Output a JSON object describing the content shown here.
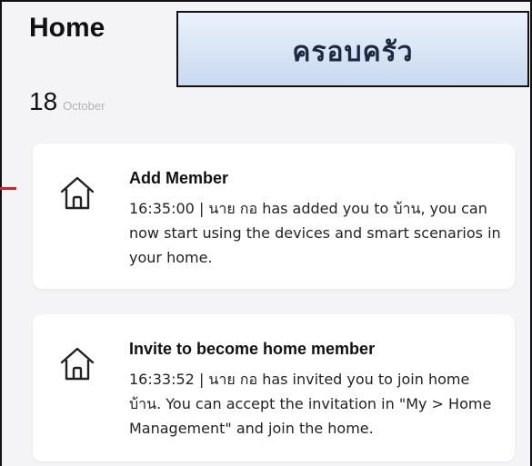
{
  "header": {
    "title": "Home",
    "banner_text": "ครอบครัว"
  },
  "date": {
    "day": "18",
    "month": "October"
  },
  "notifications": [
    {
      "icon": "home-icon",
      "title": "Add Member",
      "body": "16:35:00 | นาย กอ has added you to บ้าน, you can now start using the devices and smart scenarios in your home."
    },
    {
      "icon": "home-icon",
      "title": "Invite to become home member",
      "body": "16:33:52 | นาย กอ has invited you to join home บ้าน. You can accept the invitation in \"My > Home Management\" and join the home."
    }
  ],
  "colors": {
    "banner_gradient_top": "#eaf1fb",
    "banner_gradient_bottom": "#c9d9ef",
    "background": "#f4f4f6",
    "card": "#ffffff",
    "marker": "#d0202a"
  }
}
